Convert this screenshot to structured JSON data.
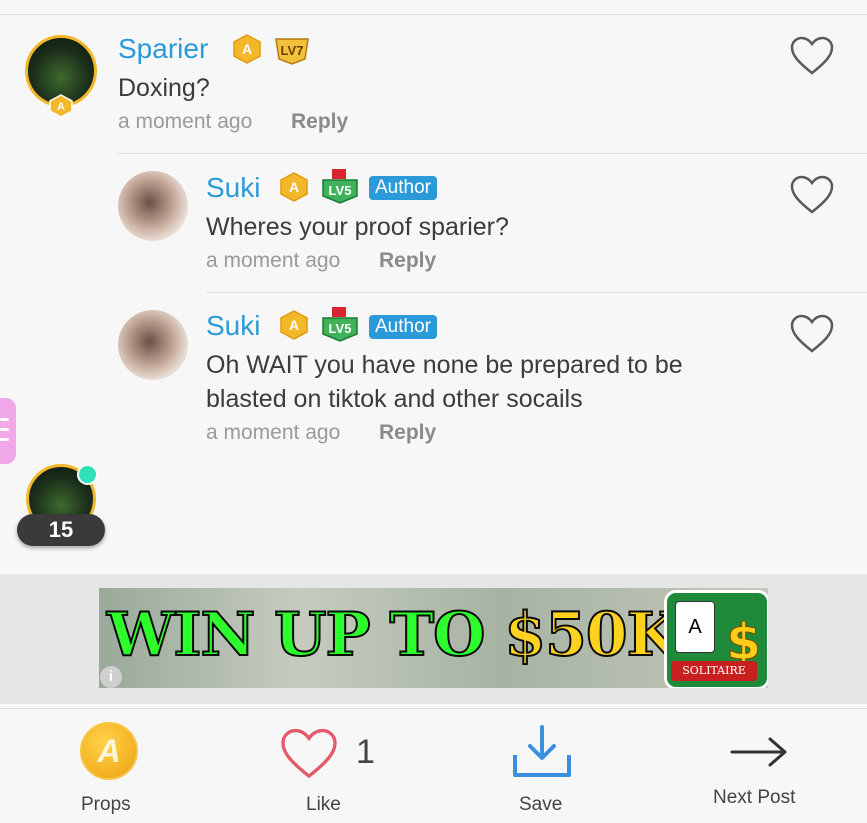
{
  "comments": [
    {
      "username": "Sparier",
      "level": "LV7",
      "text": "Doxing?",
      "time": "a moment ago",
      "reply_label": "Reply",
      "author_tag": ""
    },
    {
      "username": "Suki",
      "level": "LV5",
      "text": "Wheres your proof sparier?",
      "time": "a moment ago",
      "reply_label": "Reply",
      "author_tag": "Author"
    },
    {
      "username": "Suki",
      "level": "LV5",
      "text": "Oh WAIT you have none be prepared to be blasted on tiktok and other socails",
      "time": "a moment ago",
      "reply_label": "Reply",
      "author_tag": "Author"
    }
  ],
  "floating": {
    "count": "15"
  },
  "ad": {
    "headline": "WIN UP TO ",
    "headline_money": "$50K!",
    "logo_banner": "SOLITAIRE",
    "info_icon": "i"
  },
  "bottom_bar": {
    "props_label": "Props",
    "like_label": "Like",
    "like_count": "1",
    "save_label": "Save",
    "next_label": "Next Post"
  },
  "colors": {
    "username": "#2a9ad8",
    "author_tag": "#2a9ad8",
    "heart_outline": "#e35b6b",
    "save_icon": "#3a8fe0",
    "coin": "#f5b324"
  },
  "icons": [
    "heart-icon",
    "amino-badge-icon",
    "level-badge-icon",
    "coin-icon",
    "download-icon",
    "arrow-right-icon",
    "menu-icon",
    "info-icon"
  ]
}
